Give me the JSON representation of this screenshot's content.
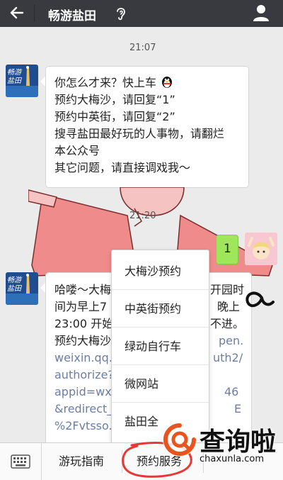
{
  "header": {
    "title": "畅游盐田",
    "back_icon": "arrow-left-icon",
    "voice_icon": "ear-icon",
    "profile_icon": "person-icon"
  },
  "chat": {
    "timestamp_1": "21:07",
    "timestamp_2": "21:20",
    "avatar_label": "畅游盐田",
    "message_1": {
      "line_1": "你怎么才来？快上车",
      "line_2": "预约大梅沙，请回复“1”",
      "line_3": "预约中英街，请回复“2”",
      "line_4": "搜寻盐田最好玩的人事物，请翻烂",
      "line_5": "本公众号",
      "line_6": "其它问题，请直接调戏我～"
    },
    "sent_message": "1",
    "message_2": {
      "line_1a": "哈喽～大梅",
      "line_1b": "开园时",
      "line_2a": "间为早上7",
      "line_2b": "晚上",
      "line_3a": "23:00 开始",
      "line_3b": "不进。",
      "line_4a": "预约大梅沙",
      "line_4b": "pen.",
      "line_5a": "weixin.qq.",
      "line_5b": "uth2/",
      "line_6a": "authorize?",
      "line_7a": "appid=wx",
      "line_7b": "46",
      "line_8a": "&redirect_",
      "line_8b": "E",
      "line_9a": "%2Fvtsso."
    }
  },
  "menu": {
    "items": [
      "大梅沙预约",
      "中英街预约",
      "绿动自行车",
      "微网站",
      "盐田全"
    ]
  },
  "bottom_bar": {
    "keyboard_icon": "keyboard-icon",
    "tabs": [
      "游玩指南",
      "预约服务"
    ]
  },
  "watermark": {
    "text": "查询啦",
    "url": "chaxunla.com"
  },
  "colors": {
    "header_bg": "#393a3f",
    "chat_bg": "#ebebeb",
    "sent_bubble": "#9ee65a",
    "link": "#6b7ea3",
    "circle_highlight": "#e53935"
  }
}
